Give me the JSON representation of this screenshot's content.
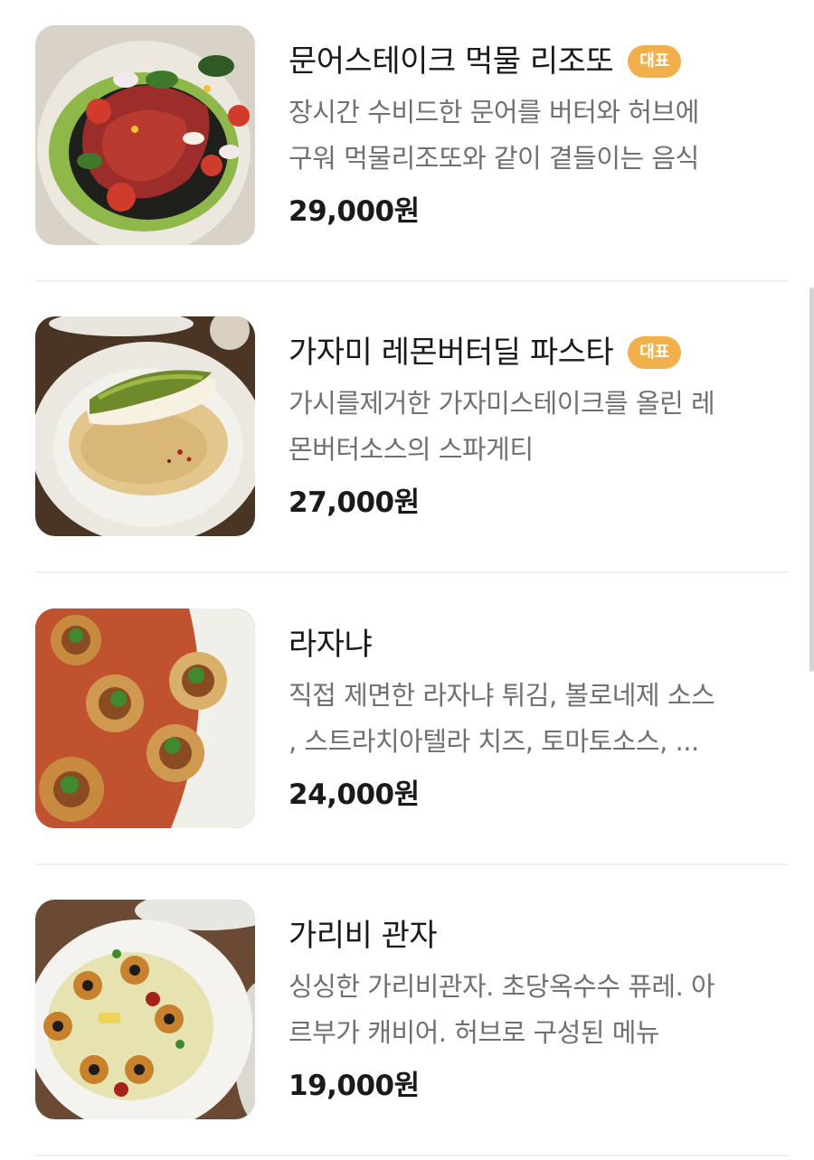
{
  "menu": {
    "items": [
      {
        "name": "문어스테이크 먹물 리조또",
        "badge": "대표",
        "description_lines": [
          "장시간 수비드한 문어를 버터와 허브에",
          "구워 먹물리조또와 같이 곁들이는 음식"
        ],
        "price": "29,000원"
      },
      {
        "name": "가자미 레몬버터딜 파스타",
        "badge": "대표",
        "description_lines": [
          "가시를제거한 가자미스테이크를 올린 레",
          "몬버터소스의 스파게티"
        ],
        "price": "27,000원"
      },
      {
        "name": "라자냐",
        "description_lines": [
          "직접 제면한 라자냐 튀김, 볼로네제 소스",
          ", 스트라치아텔라 치즈, 토마토소스, ..."
        ],
        "price": "24,000원"
      },
      {
        "name": "가리비 관자",
        "description_lines": [
          "싱싱한 가리비관자. 초당옥수수 퓨레. 아",
          "르부가 캐비어. 허브로 구성된 메뉴"
        ],
        "price": "19,000원"
      }
    ]
  },
  "colors": {
    "badge_bg": "#f2b04c",
    "text_primary": "#1a1a1a",
    "text_secondary": "#707070",
    "divider": "#efefef"
  }
}
